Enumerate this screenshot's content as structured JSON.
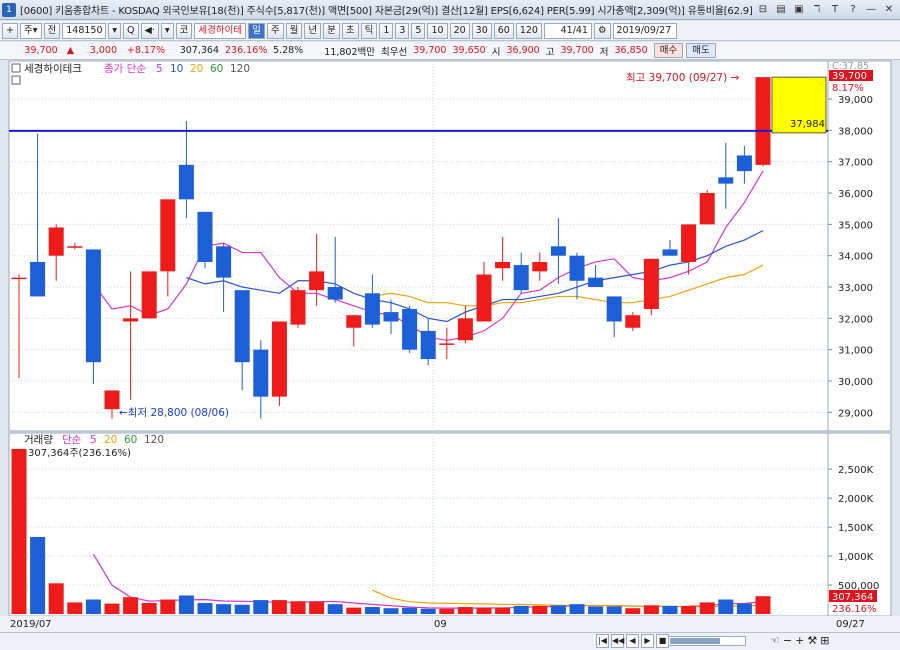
{
  "window": {
    "icon_label": "1",
    "title": "[0600] 키움종합차트 - KOSDAQ 외국인보유[18(천)] 주식수[5,817(천)] 액면[500] 자본금[29(억)] 결산[12월] EPS[6,624] PER[5.99] 시가총액[2,309(억)] 유통비율[62.9]",
    "buttons": [
      "⊟",
      "▤",
      "▣",
      "ℸ",
      "T",
      "?",
      "—",
      "✕"
    ]
  },
  "toolbar": {
    "left_buttons": [
      "+",
      "주",
      "▾",
      "전"
    ],
    "code": "148150",
    "icons": [
      "▾",
      "Q",
      "◀·",
      "▾"
    ],
    "code_prefix": "코",
    "stock_name": "세경하이테",
    "period_selected": "일",
    "periods": [
      "주",
      "월",
      "년",
      "분",
      "초",
      "틱",
      "1",
      "3",
      "5",
      "10",
      "20",
      "30",
      "60",
      "120"
    ],
    "page": "41",
    "page_total": "/41",
    "date": "2019/09/27"
  },
  "quote": {
    "price": "39,700",
    "change_mark": "▲",
    "change": "3,000",
    "change_pct": "+8.17%",
    "volume": "307,364",
    "volume_ratio": "236.16%",
    "turnover": "5.28%",
    "amount": "11,802백만",
    "priority": "최우선",
    "ask": "39,700",
    "bid": "39,650",
    "open_label": "시",
    "open": "36,900",
    "high_label": "고",
    "high": "39,700",
    "low_label": "저",
    "low": "36,850",
    "buy_label": "매수",
    "sell_label": "매도"
  },
  "price_panel": {
    "stock_name": "세경하이테크",
    "ma_label": "종가 단순",
    "ma_periods": [
      "5",
      "10",
      "20",
      "60",
      "120"
    ],
    "ma_colors": [
      "#d638c8",
      "#2c52c8",
      "#e8a40c",
      "#2a9d3a",
      "#555555"
    ],
    "y_ticks": [
      "39,000",
      "38,000",
      "37,000",
      "36,000",
      "35,000",
      "34,000",
      "33,000",
      "32,000",
      "31,000",
      "30,000",
      "29,000"
    ],
    "top_right_label": "C:37.85",
    "last_price_tag": "39,700",
    "last_pct_tag": "8.17%",
    "hline_value_label": "37,984",
    "max_annotation": "최고 39,700 (09/27) →",
    "min_annotation": "←최저 28,800 (08/06)"
  },
  "volume_panel": {
    "label": "거래량",
    "ma_label": "단순",
    "ma_periods": [
      "5",
      "20",
      "60",
      "120"
    ],
    "current": "307,364주(236.16%)",
    "y_ticks": [
      "2,500K",
      "2,000K",
      "1,500K",
      "1,000K",
      "500,000"
    ],
    "last_volume_tag": "307,364",
    "last_pct_tag": "236.16%"
  },
  "x_axis": {
    "labels": [
      "2019/07",
      "09",
      "09/27"
    ]
  },
  "chart_data": {
    "type": "candlestick",
    "y_range": [
      28500,
      39800
    ],
    "volume_range": [
      0,
      2900000
    ],
    "hline": 37984,
    "candles": [
      {
        "o": 33300,
        "h": 33400,
        "l": 30100,
        "c": 33300
      },
      {
        "o": 33800,
        "h": 37900,
        "l": 32800,
        "c": 32700
      },
      {
        "o": 34000,
        "h": 35000,
        "l": 33200,
        "c": 34900
      },
      {
        "o": 34300,
        "h": 34400,
        "l": 34200,
        "c": 34300
      },
      {
        "o": 34200,
        "h": 34200,
        "l": 29900,
        "c": 30600
      },
      {
        "o": 29100,
        "h": 29700,
        "l": 28800,
        "c": 29700
      },
      {
        "o": 31900,
        "h": 33500,
        "l": 29400,
        "c": 32000
      },
      {
        "o": 32000,
        "h": 33500,
        "l": 32000,
        "c": 33500
      },
      {
        "o": 33500,
        "h": 35800,
        "l": 32700,
        "c": 35800
      },
      {
        "o": 36900,
        "h": 38300,
        "l": 35200,
        "c": 35800
      },
      {
        "o": 35400,
        "h": 35400,
        "l": 33600,
        "c": 33800
      },
      {
        "o": 34300,
        "h": 34400,
        "l": 32200,
        "c": 33300
      },
      {
        "o": 32900,
        "h": 32900,
        "l": 29700,
        "c": 30600
      },
      {
        "o": 31000,
        "h": 31300,
        "l": 28800,
        "c": 29500
      },
      {
        "o": 29500,
        "h": 31900,
        "l": 29200,
        "c": 31900
      },
      {
        "o": 31800,
        "h": 33000,
        "l": 31700,
        "c": 32900
      },
      {
        "o": 32900,
        "h": 34700,
        "l": 32400,
        "c": 33500
      },
      {
        "o": 33000,
        "h": 34600,
        "l": 32500,
        "c": 32600
      },
      {
        "o": 31700,
        "h": 32100,
        "l": 31100,
        "c": 32100
      },
      {
        "o": 32800,
        "h": 33400,
        "l": 31700,
        "c": 31800
      },
      {
        "o": 32200,
        "h": 32600,
        "l": 31500,
        "c": 31900
      },
      {
        "o": 32300,
        "h": 32400,
        "l": 30900,
        "c": 31000
      },
      {
        "o": 31600,
        "h": 32000,
        "l": 30500,
        "c": 30700
      },
      {
        "o": 31200,
        "h": 31700,
        "l": 30700,
        "c": 31200
      },
      {
        "o": 31300,
        "h": 32400,
        "l": 31200,
        "c": 32000
      },
      {
        "o": 31900,
        "h": 33800,
        "l": 31900,
        "c": 33400
      },
      {
        "o": 33600,
        "h": 34600,
        "l": 33200,
        "c": 33800
      },
      {
        "o": 33700,
        "h": 34100,
        "l": 32800,
        "c": 32900
      },
      {
        "o": 33500,
        "h": 34100,
        "l": 33200,
        "c": 33800
      },
      {
        "o": 34300,
        "h": 35200,
        "l": 33100,
        "c": 34000
      },
      {
        "o": 34000,
        "h": 34100,
        "l": 32600,
        "c": 33200
      },
      {
        "o": 33300,
        "h": 33700,
        "l": 33100,
        "c": 33000
      },
      {
        "o": 32700,
        "h": 32700,
        "l": 31400,
        "c": 31900
      },
      {
        "o": 31700,
        "h": 32200,
        "l": 31600,
        "c": 32100
      },
      {
        "o": 32300,
        "h": 33900,
        "l": 32100,
        "c": 33900
      },
      {
        "o": 34200,
        "h": 34500,
        "l": 34000,
        "c": 34000
      },
      {
        "o": 33800,
        "h": 35000,
        "l": 33400,
        "c": 35000
      },
      {
        "o": 35000,
        "h": 36100,
        "l": 35000,
        "c": 36000
      },
      {
        "o": 36500,
        "h": 37600,
        "l": 35500,
        "c": 36300
      },
      {
        "o": 37200,
        "h": 37500,
        "l": 36300,
        "c": 36700
      },
      {
        "o": 36900,
        "h": 39700,
        "l": 36850,
        "c": 39700
      }
    ],
    "volumes": [
      2850000,
      1330000,
      530000,
      200000,
      250000,
      180000,
      290000,
      190000,
      250000,
      320000,
      190000,
      170000,
      160000,
      240000,
      240000,
      220000,
      210000,
      170000,
      110000,
      120000,
      100000,
      110000,
      90000,
      90000,
      120000,
      110000,
      110000,
      140000,
      140000,
      150000,
      170000,
      130000,
      130000,
      100000,
      150000,
      140000,
      140000,
      200000,
      250000,
      180000,
      307364
    ],
    "ma5": [
      null,
      null,
      null,
      null,
      33100,
      32300,
      32400,
      32100,
      32300,
      33100,
      34300,
      34400,
      34100,
      34100,
      33300,
      32800,
      32800,
      32600,
      32400,
      32200,
      32100,
      31800,
      31400,
      31300,
      31400,
      31600,
      32000,
      32800,
      32900,
      33300,
      33600,
      33800,
      33900,
      33300,
      33200,
      33300,
      33500,
      33800,
      34900,
      35700,
      36700
    ],
    "ma10": [
      null,
      null,
      null,
      null,
      null,
      null,
      null,
      null,
      null,
      33300,
      33100,
      33200,
      33000,
      32900,
      32800,
      33200,
      33200,
      33100,
      32800,
      32600,
      32500,
      32300,
      32000,
      31900,
      32200,
      32400,
      32600,
      32600,
      32700,
      32800,
      33000,
      33200,
      33300,
      33400,
      33500,
      33700,
      33800,
      34000,
      34300,
      34500,
      34800
    ],
    "ma20": [
      null,
      null,
      null,
      null,
      null,
      null,
      null,
      null,
      null,
      null,
      null,
      null,
      null,
      null,
      null,
      null,
      null,
      null,
      null,
      32700,
      32800,
      32700,
      32500,
      32500,
      32400,
      32400,
      32500,
      32500,
      32600,
      32700,
      32700,
      32600,
      32500,
      32500,
      32600,
      32700,
      32900,
      33100,
      33300,
      33400,
      33700
    ]
  }
}
